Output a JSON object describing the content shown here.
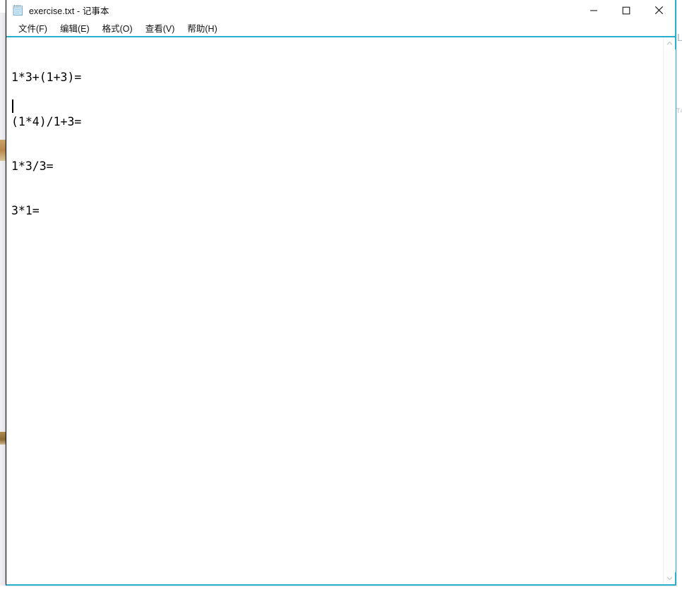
{
  "window": {
    "title": "exercise.txt - 记事本",
    "icon": "notepad-icon",
    "controls": {
      "minimize": "−",
      "maximize": "□",
      "close": "✕",
      "minimize_name": "minimize",
      "maximize_name": "maximize",
      "close_name": "close"
    },
    "border_color": "#29aecd"
  },
  "menu": {
    "items": [
      {
        "label": "文件(F)",
        "name": "file"
      },
      {
        "label": "编辑(E)",
        "name": "edit"
      },
      {
        "label": "格式(O)",
        "name": "format"
      },
      {
        "label": "查看(V)",
        "name": "view"
      },
      {
        "label": "帮助(H)",
        "name": "help"
      }
    ]
  },
  "editor": {
    "lines": [
      "1*3+(1+3)=",
      "(1*4)/1+3=",
      "1*3/3=",
      "3*1=",
      ""
    ],
    "caret_line": 5,
    "caret_column": 1,
    "text_color": "#000000",
    "background_color": "#ffffff"
  },
  "scrollbar": {
    "up_arrow": "⌃",
    "down_arrow": "⌄",
    "track_color": "#fcfcfc"
  },
  "background": {
    "ghost_fragments": [
      "L",
      "T4"
    ]
  }
}
